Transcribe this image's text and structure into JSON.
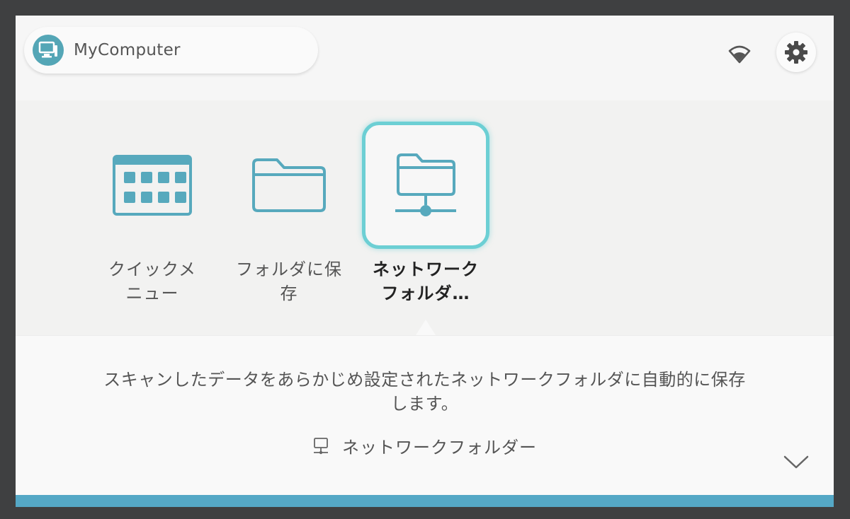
{
  "header": {
    "device_name": "MyComputer",
    "device_icon": "computer-icon",
    "wifi_icon": "wifi-icon",
    "settings_icon": "gear-icon"
  },
  "apps": [
    {
      "label_line1": "クイックメ",
      "label_line2": "ニュー",
      "icon": "grid-menu-icon",
      "selected": false
    },
    {
      "label_line1": "フォルダに保",
      "label_line2": "存",
      "icon": "folder-icon",
      "selected": false
    },
    {
      "label_line1": "ネットワーク",
      "label_line2": "フォルダ…",
      "icon": "network-folder-icon",
      "selected": true
    }
  ],
  "description": {
    "line1": "スキャンしたデータをあらかじめ設定されたネットワークフォルダに自動的に保存",
    "line2": "します。"
  },
  "destination": {
    "label": "ネットワークフォルダー",
    "icon": "network-computer-icon"
  },
  "colors": {
    "accent": "#54a6b6",
    "highlight": "#6ccfd4",
    "bottom_bar": "#55a8c6"
  }
}
